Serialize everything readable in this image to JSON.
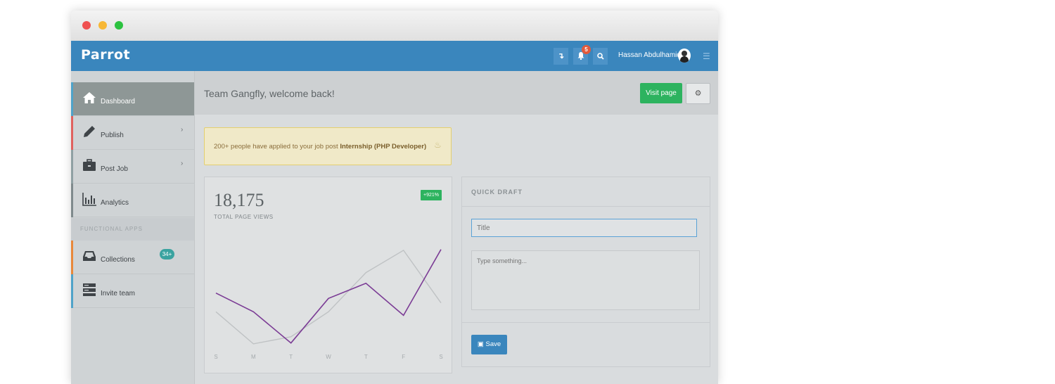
{
  "navbar": {
    "brand": "Parrot",
    "btn1_glyph": "↴",
    "notification_count": "5",
    "user_name": "Hassan Abdulhamid"
  },
  "sidebar": {
    "items": [
      {
        "label": "Dashboard",
        "icon": "home-icon",
        "accent": "#4fa3c9"
      },
      {
        "label": "Publish",
        "icon": "pencil-icon",
        "accent": "#e0615e"
      },
      {
        "label": "Post Job",
        "icon": "briefcase-icon",
        "accent": "#8fa0a3"
      },
      {
        "label": "Analytics",
        "icon": "bar-chart-icon",
        "accent": "#7f8a8c"
      }
    ],
    "section_label": "FUNCTIONAL APPS",
    "apps": [
      {
        "label": "Collections",
        "icon": "inbox-icon",
        "accent": "#e8883a",
        "badge": "34+"
      },
      {
        "label": "Invite team",
        "icon": "server-icon",
        "accent": "#4fa3c9"
      }
    ]
  },
  "header": {
    "welcome": "Team Gangfly, welcome back!",
    "visit_label": "Visit page"
  },
  "alert": {
    "text": "200+ people have applied to your job post ",
    "bold": "Internship (PHP Developer)"
  },
  "stats": {
    "total": "18,175",
    "label": "TOTAL PAGE VIEWS",
    "change": "+921%"
  },
  "chart_data": {
    "type": "line",
    "categories": [
      "S",
      "M",
      "T",
      "W",
      "T",
      "F",
      "S"
    ],
    "series": [
      {
        "values": [
          4.0,
          0.4,
          1.2,
          4.0,
          8.4,
          10.9,
          5.0
        ],
        "color": "#bfc2c4"
      },
      {
        "values": [
          6.1,
          4.0,
          0.5,
          5.5,
          7.2,
          3.6,
          11.0
        ],
        "color": "#7b3c95"
      }
    ],
    "ylim": [
      0,
      12
    ]
  },
  "draft": {
    "title": "QUICK DRAFT",
    "title_placeholder": "Title",
    "body_placeholder": "Type something...",
    "save_label": "Save"
  }
}
